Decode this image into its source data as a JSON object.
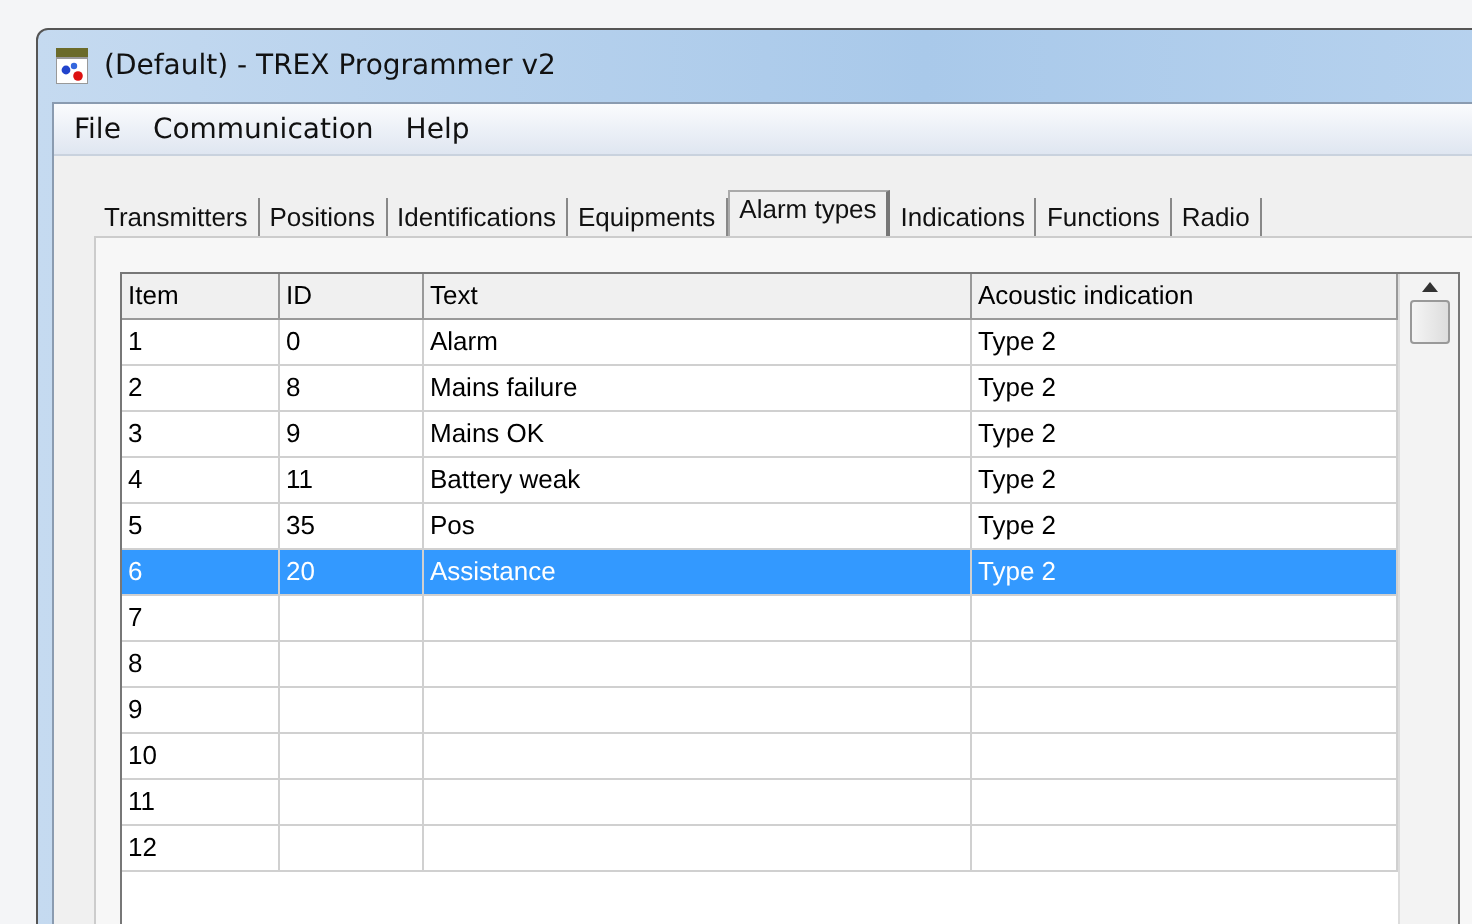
{
  "window": {
    "title": "(Default) - TREX Programmer v2"
  },
  "menu": [
    "File",
    "Communication",
    "Help"
  ],
  "tabs": [
    {
      "label": "Transmitters",
      "selected": false
    },
    {
      "label": "Positions",
      "selected": false
    },
    {
      "label": "Identifications",
      "selected": false
    },
    {
      "label": "Equipments",
      "selected": false
    },
    {
      "label": "Alarm types",
      "selected": true
    },
    {
      "label": "Indications",
      "selected": false
    },
    {
      "label": "Functions",
      "selected": false
    },
    {
      "label": "Radio",
      "selected": false
    }
  ],
  "table": {
    "columns": [
      "Item",
      "ID",
      "Text",
      "Acoustic indication"
    ],
    "rows": [
      {
        "cells": [
          "1",
          "0",
          "Alarm",
          "Type 2"
        ],
        "selected": false
      },
      {
        "cells": [
          "2",
          "8",
          "Mains failure",
          "Type 2"
        ],
        "selected": false
      },
      {
        "cells": [
          "3",
          "9",
          "Mains OK",
          "Type 2"
        ],
        "selected": false
      },
      {
        "cells": [
          "4",
          "11",
          "Battery weak",
          "Type 2"
        ],
        "selected": false
      },
      {
        "cells": [
          "5",
          "35",
          "Pos",
          "Type 2"
        ],
        "selected": false
      },
      {
        "cells": [
          "6",
          "20",
          "Assistance",
          "Type 2"
        ],
        "selected": true
      },
      {
        "cells": [
          "7"
        ],
        "selected": false
      },
      {
        "cells": [
          "8"
        ],
        "selected": false
      },
      {
        "cells": [
          "9"
        ],
        "selected": false
      },
      {
        "cells": [
          "10"
        ],
        "selected": false
      },
      {
        "cells": [
          "11"
        ],
        "selected": false
      },
      {
        "cells": [
          "12"
        ],
        "selected": false
      }
    ]
  }
}
